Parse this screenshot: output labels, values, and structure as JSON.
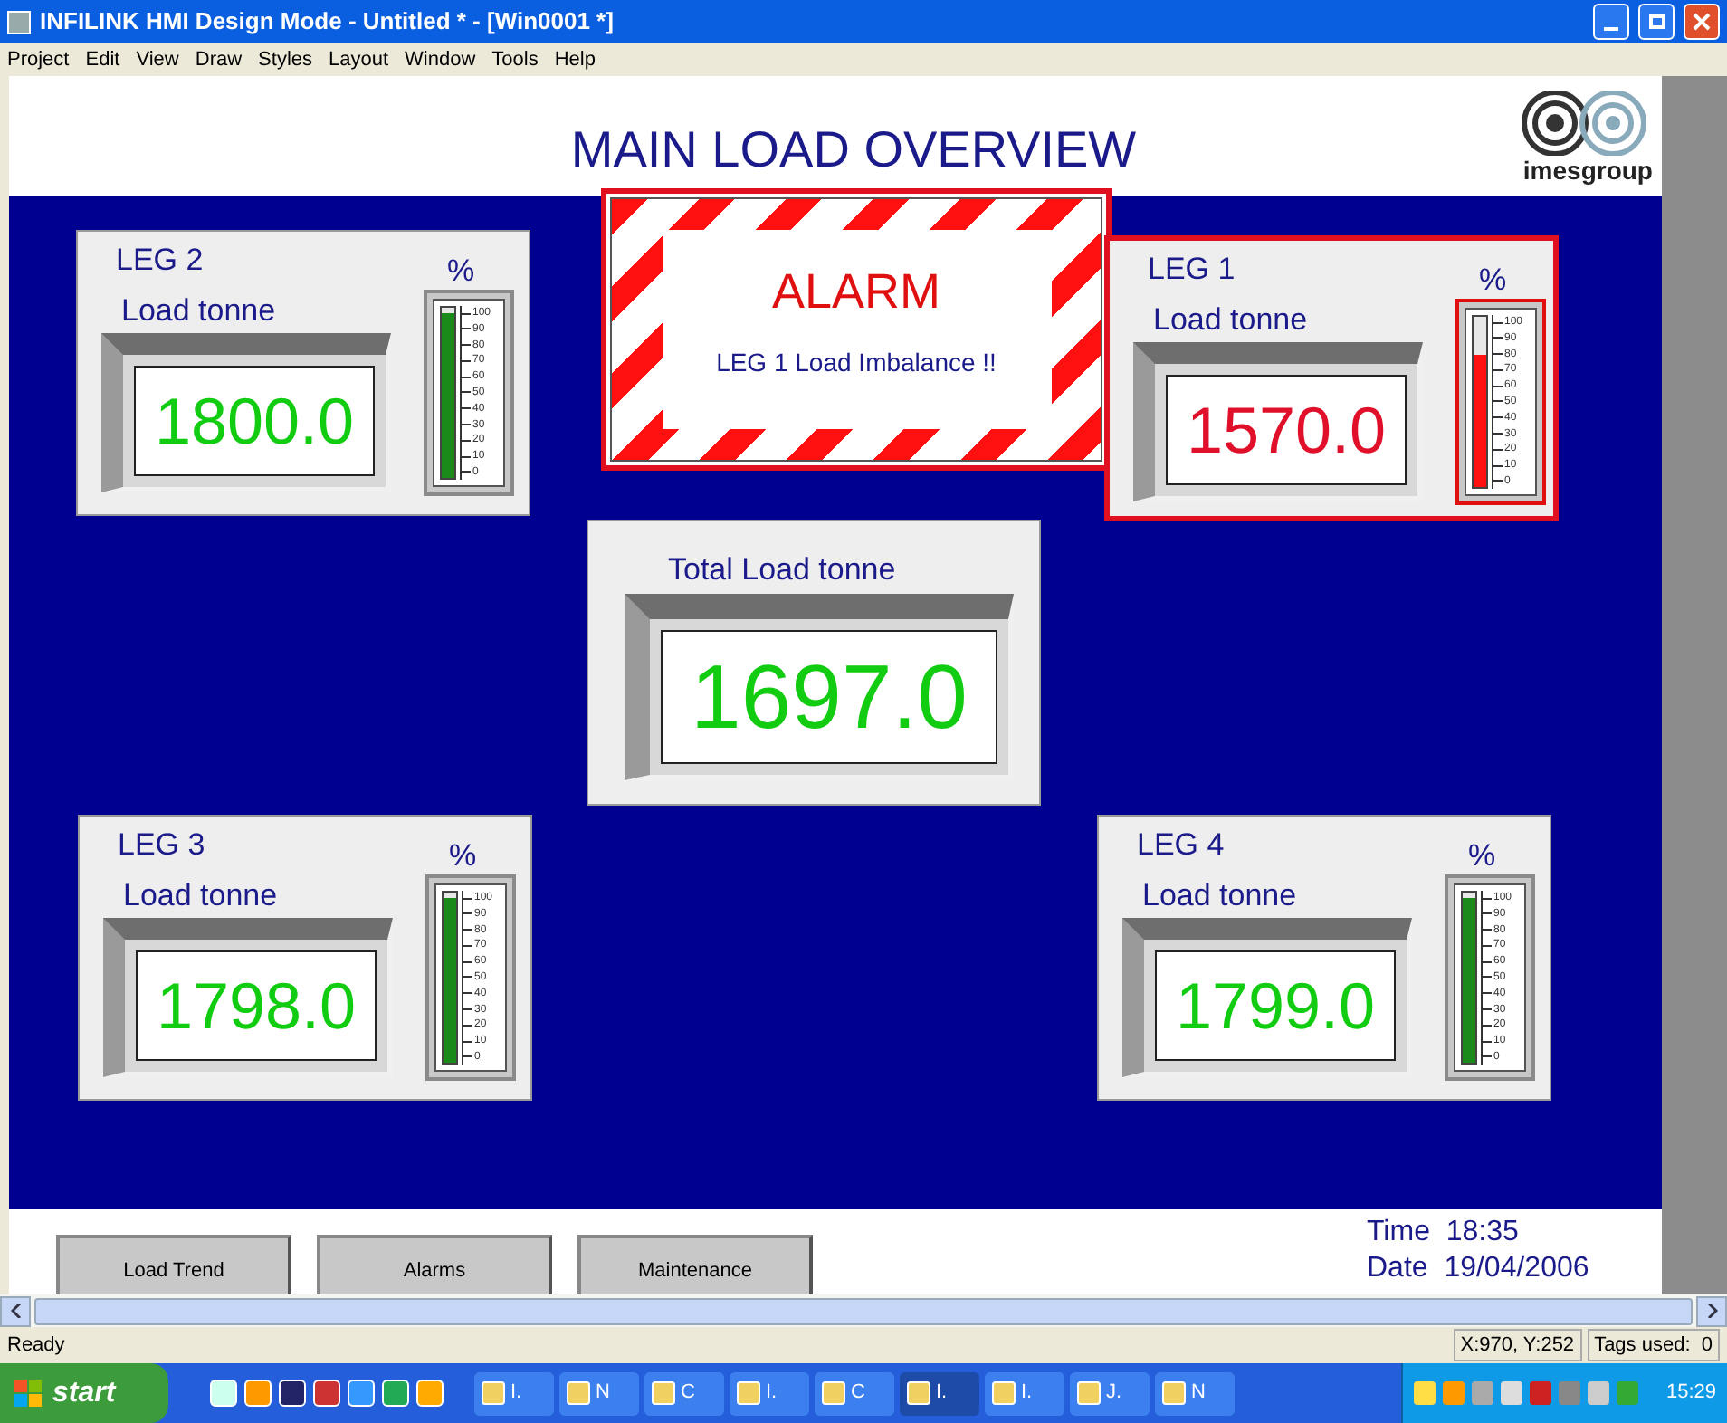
{
  "window": {
    "title": "INFILINK HMI Design Mode - Untitled * - [Win0001 *]"
  },
  "menu": [
    "Project",
    "Edit",
    "View",
    "Draw",
    "Styles",
    "Layout",
    "Window",
    "Tools",
    "Help"
  ],
  "screen_title": "MAIN LOAD OVERVIEW",
  "logo": {
    "text": "imesgroup"
  },
  "alarm": {
    "title": "ALARM",
    "message": "LEG 1 Load Imbalance !!"
  },
  "legs": [
    {
      "title": "LEG 2",
      "unit": "%",
      "label": "Load tonne",
      "value": "1800.0",
      "alarm": false,
      "level": 0.97,
      "scale": [
        "100",
        "90",
        "80",
        "70",
        "60",
        "50",
        "40",
        "30",
        "20",
        "10",
        "0"
      ]
    },
    {
      "title": "LEG 1",
      "unit": "%",
      "label": "Load tonne",
      "value": "1570.0",
      "alarm": true,
      "level": 0.78,
      "scale": [
        "100",
        "90",
        "80",
        "70",
        "60",
        "50",
        "40",
        "30",
        "20",
        "10",
        "0"
      ]
    },
    {
      "title": "LEG 3",
      "unit": "%",
      "label": "Load tonne",
      "value": "1798.0",
      "alarm": false,
      "level": 0.97,
      "scale": [
        "100",
        "90",
        "80",
        "70",
        "60",
        "50",
        "40",
        "30",
        "20",
        "10",
        "0"
      ]
    },
    {
      "title": "LEG 4",
      "unit": "%",
      "label": "Load tonne",
      "value": "1799.0",
      "alarm": false,
      "level": 0.97,
      "scale": [
        "100",
        "90",
        "80",
        "70",
        "60",
        "50",
        "40",
        "30",
        "20",
        "10",
        "0"
      ]
    }
  ],
  "total": {
    "label": "Total Load tonne",
    "value": "1697.0"
  },
  "buttons": [
    "Load Trend",
    "Alarms",
    "Maintenance"
  ],
  "time": {
    "label": "Time",
    "value": "18:35"
  },
  "date": {
    "label": "Date",
    "value": "19/04/2006"
  },
  "status_bar": {
    "text": "Ready",
    "coords": "X:970, Y:252",
    "tags": "Tags used:  0"
  },
  "taskbar": {
    "start": "start",
    "tasks": [
      {
        "label": "I.",
        "selected": false
      },
      {
        "label": "N",
        "selected": false
      },
      {
        "label": "C",
        "selected": false
      },
      {
        "label": "I.",
        "selected": false
      },
      {
        "label": "C",
        "selected": false
      },
      {
        "label": "I.",
        "selected": true
      },
      {
        "label": "I.",
        "selected": false
      },
      {
        "label": "J.",
        "selected": false
      },
      {
        "label": "N",
        "selected": false
      }
    ],
    "clock": "15:29"
  }
}
